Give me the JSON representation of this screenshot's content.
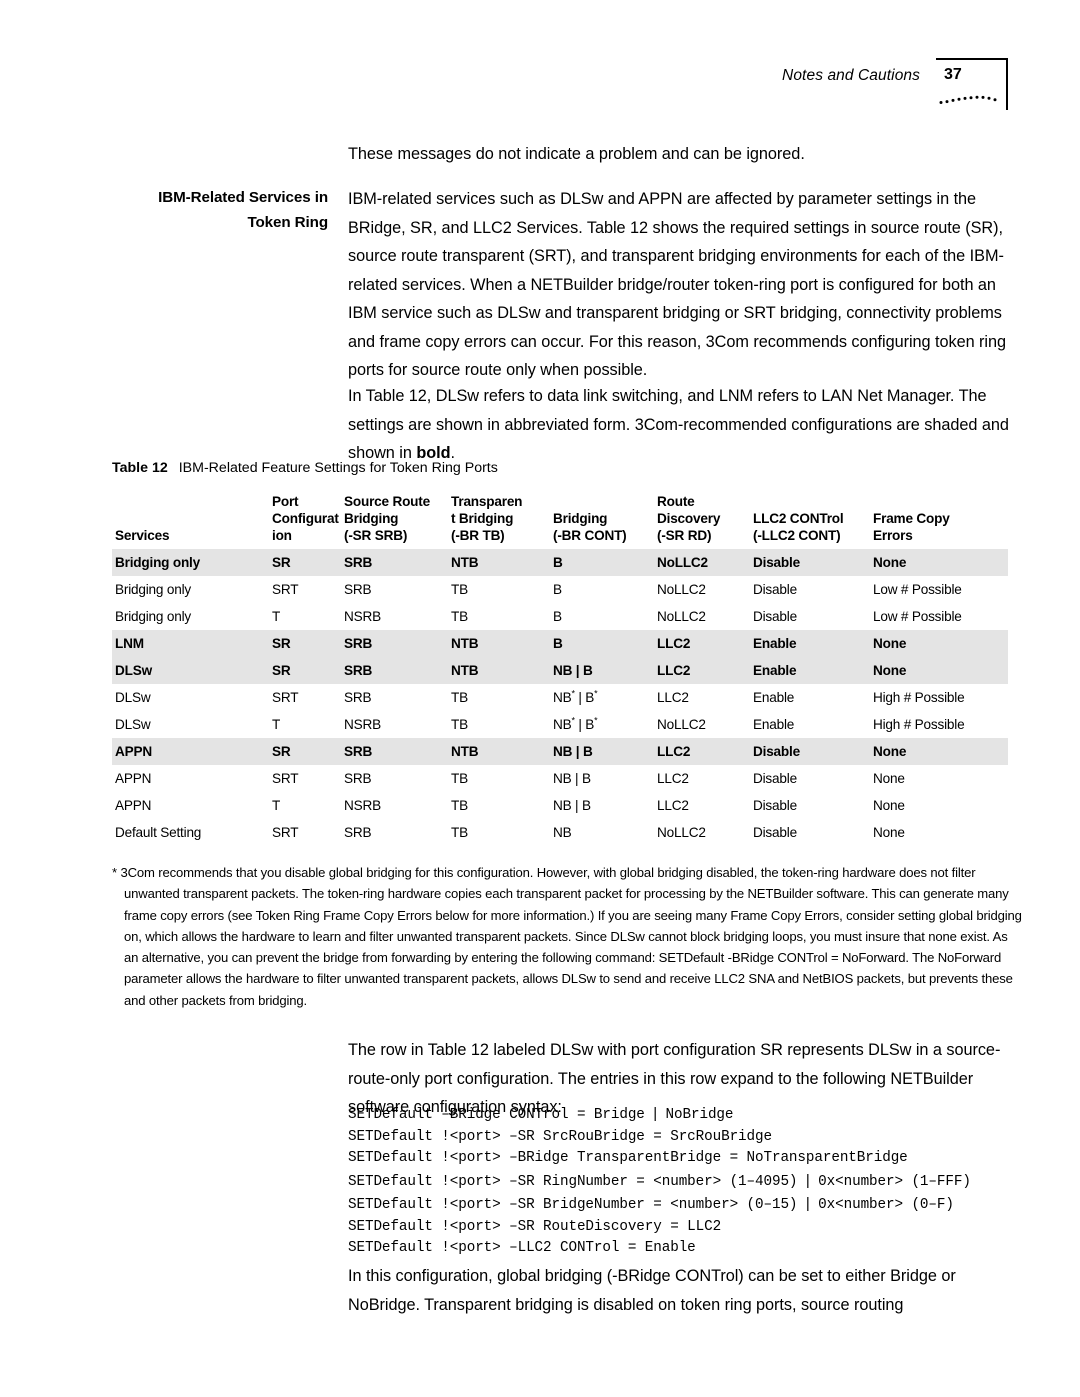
{
  "header": {
    "title": "Notes and Cautions",
    "page_number": "37",
    "corner_icon": "dotted-arc-decoration"
  },
  "intro": {
    "lead_paragraph": "These messages do not indicate a problem and can be ignored."
  },
  "section": {
    "side_heading_line1": "IBM-Related Services in",
    "side_heading_line2": "Token Ring",
    "paragraph_1": "IBM-related services such as DLSw and APPN are affected by parameter settings in the BRidge, SR, and LLC2 Services. Table 12 shows the required settings in source route (SR), source route transparent (SRT), and transparent bridging environments for each of the IBM-related services. When a NETBuilder bridge/router token-ring port is configured for both an IBM service such as DLSw and transparent bridging or SRT bridging, connectivity problems and frame copy errors can occur. For this reason, 3Com recommends configuring token ring ports for source route only when possible.",
    "paragraph_2_pre": "In Table 12, DLSw refers to data link switching, and LNM refers to LAN Net Manager. The settings are shown in abbreviated form. 3Com-recommended configurations are shaded and shown in ",
    "paragraph_2_bold": "bold",
    "paragraph_2_post": "."
  },
  "table": {
    "caption_label": "Table 12",
    "caption_text": "IBM-Related Feature Settings for Token Ring Ports",
    "headers": [
      "Services",
      "Port Configuration",
      "Source Route Bridging (-SR SRB)",
      "Transparent Bridging (-BR TB)",
      "Bridging (-BR CONT)",
      "Route Discovery (-SR RD)",
      "LLC2 CONTrol (-LLC2 CONT)",
      "Frame Copy Errors"
    ],
    "header_lines": [
      [
        "",
        "",
        "Services"
      ],
      [
        "Port",
        "Configurat",
        "ion"
      ],
      [
        "Source Route",
        "Bridging",
        "(-SR SRB)"
      ],
      [
        "Transparen",
        "t Bridging",
        "(-BR TB)"
      ],
      [
        "",
        "Bridging",
        "(-BR CONT)"
      ],
      [
        "Route",
        "Discovery",
        "(-SR RD)"
      ],
      [
        "",
        "LLC2 CONTrol",
        "(-LLC2 CONT)"
      ],
      [
        "",
        "Frame Copy",
        "Errors"
      ]
    ],
    "rows": [
      {
        "shaded": true,
        "cells": [
          "Bridging only",
          "SR",
          "SRB",
          "NTB",
          "B",
          "NoLLC2",
          "Disable",
          "None"
        ]
      },
      {
        "shaded": false,
        "cells": [
          "Bridging only",
          "SRT",
          "SRB",
          "TB",
          "B",
          "NoLLC2",
          "Disable",
          "Low # Possible"
        ]
      },
      {
        "shaded": false,
        "cells": [
          "Bridging only",
          "T",
          "NSRB",
          "TB",
          "B",
          "NoLLC2",
          "Disable",
          "Low # Possible"
        ]
      },
      {
        "shaded": true,
        "cells": [
          "LNM",
          "SR",
          "SRB",
          "NTB",
          "B",
          "LLC2",
          "Enable",
          "None"
        ]
      },
      {
        "shaded": true,
        "cells": [
          "DLSw",
          "SR",
          "SRB",
          "NTB",
          "NB | B",
          "LLC2",
          "Enable",
          "None"
        ]
      },
      {
        "shaded": false,
        "cells": [
          "DLSw",
          "SRT",
          "SRB",
          "TB",
          "NB* | B*",
          "LLC2",
          "Enable",
          "High # Possible"
        ]
      },
      {
        "shaded": false,
        "cells": [
          "DLSw",
          "T",
          "NSRB",
          "TB",
          "NB* | B*",
          "NoLLC2",
          "Enable",
          "High # Possible"
        ]
      },
      {
        "shaded": true,
        "cells": [
          "APPN",
          "SR",
          "SRB",
          "NTB",
          "NB | B",
          "LLC2",
          "Disable",
          "None"
        ]
      },
      {
        "shaded": false,
        "cells": [
          "APPN",
          "SRT",
          "SRB",
          "TB",
          "NB | B",
          "LLC2",
          "Disable",
          "None"
        ]
      },
      {
        "shaded": false,
        "cells": [
          "APPN",
          "T",
          "NSRB",
          "TB",
          "NB | B",
          "LLC2",
          "Disable",
          "None"
        ]
      },
      {
        "shaded": false,
        "cells": [
          "Default Setting",
          "SRT",
          "SRB",
          "TB",
          "NB",
          "NoLLC2",
          "Disable",
          "None"
        ]
      }
    ]
  },
  "footnote": {
    "marker": "*",
    "text": "3Com recommends that you disable global bridging for this configuration. However, with global bridging disabled, the token-ring hardware does not filter unwanted transparent packets. The token-ring hardware copies each transparent packet for processing by the NETBuilder software. This can generate many frame copy errors (see Token Ring Frame Copy Errors below for more information.) If you are seeing many Frame Copy Errors, consider setting global bridging on, which allows the hardware to learn and filter unwanted transparent packets. Since DLSw cannot block bridging loops, you must insure that none exist. As an alternative, you can prevent the bridge from forwarding by entering the following command: SETDefault -BRidge CONTrol = NoForward. The NoForward parameter allows the hardware to filter unwanted transparent packets, allows DLSw to send and receive LLC2 SNA and NetBIOS packets, but prevents these and other packets from bridging."
  },
  "after_table": {
    "paragraph": "The row in Table 12 labeled DLSw with port configuration SR represents DLSw in a source-route-only port configuration. The entries in this row expand to the following NETBuilder software configuration syntax:"
  },
  "code_block": {
    "lines": [
      "SETDefault –BRidge CONTrol = Bridge | NoBridge",
      "SETDefault !<port> –SR SrcRouBridge = SrcRouBridge",
      "SETDefault !<port> –BRidge TransparentBridge = NoTransparentBridge",
      "SETDefault !<port> –SR RingNumber = <number> (1–4095) | 0x<number> (1–FFF)",
      "SETDefault !<port> –SR BridgeNumber = <number> (0–15) | 0x<number> (0–F)",
      "SETDefault !<port> –SR RouteDiscovery = LLC2",
      "SETDefault !<port> –LLC2 CONTrol = Enable"
    ]
  },
  "closing": {
    "paragraph": "In this configuration, global bridging (-BRidge CONTrol) can be set to either Bridge or NoBridge. Transparent bridging is disabled on token ring ports, source routing"
  }
}
